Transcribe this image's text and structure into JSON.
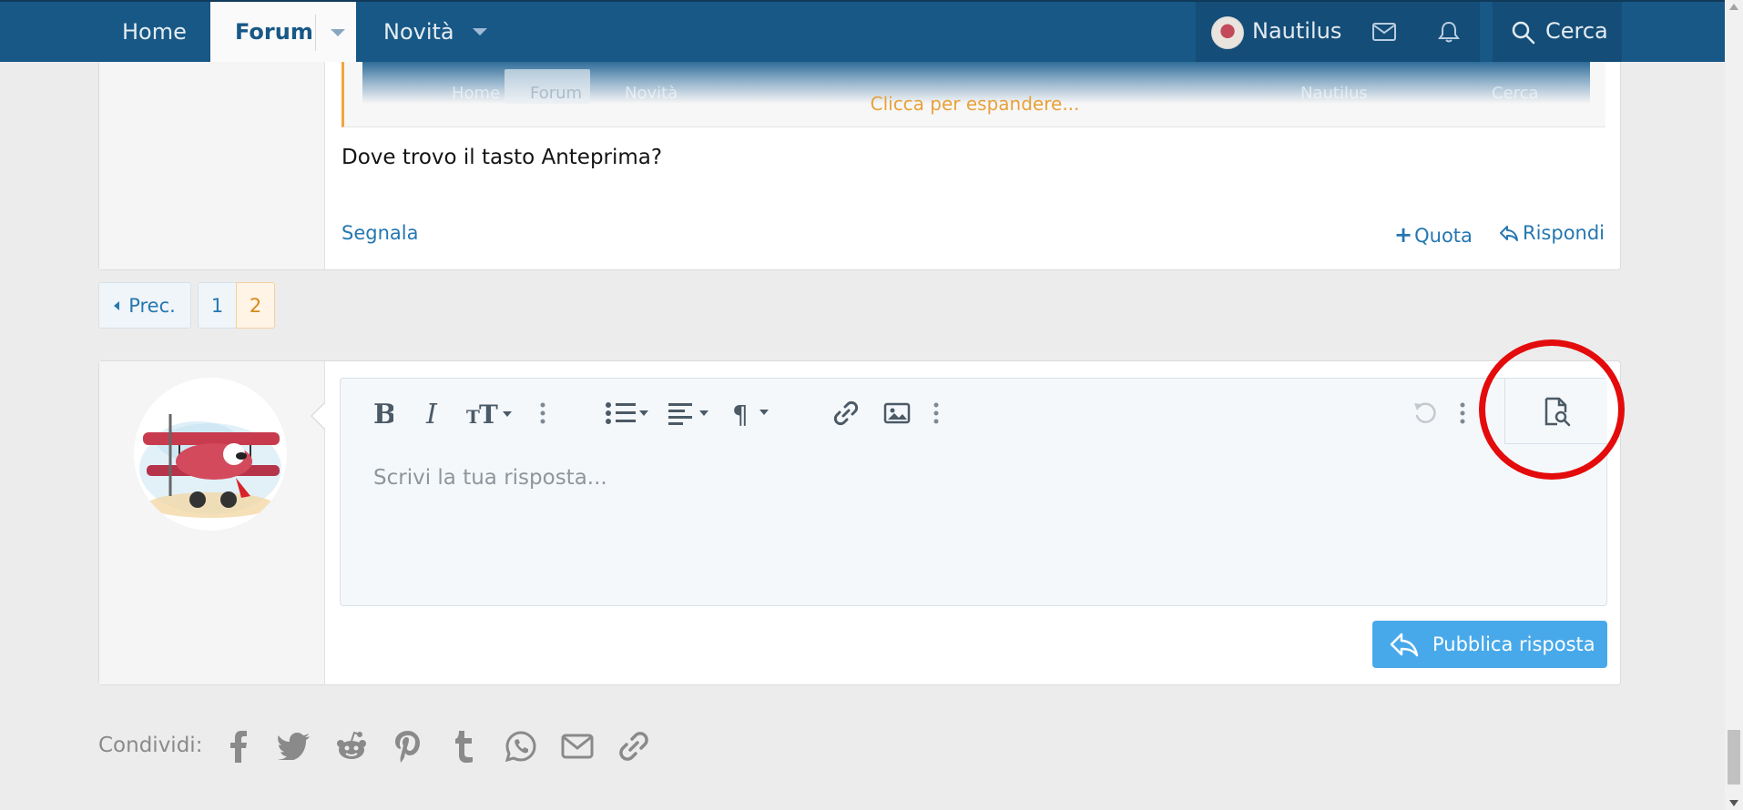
{
  "nav": {
    "home": "Home",
    "forum": "Forum",
    "novita": "Novità",
    "user": "Nautilus",
    "search": "Cerca"
  },
  "quote": {
    "ghost_home": "Home",
    "ghost_forum": "Forum",
    "ghost_novita": "Novità",
    "ghost_user": "Nautilus",
    "ghost_search": "Cerca",
    "expand": "Clicca per espandere..."
  },
  "post": {
    "text": "Dove trovo il tasto Anteprima?",
    "report": "Segnala",
    "quote": "Quota",
    "reply": "Rispondi"
  },
  "pagination": {
    "prev": "Prec.",
    "pages": [
      "1",
      "2"
    ],
    "current": "2"
  },
  "editor": {
    "placeholder": "Scrivi la tua risposta...",
    "submit": "Pubblica risposta"
  },
  "share": {
    "label": "Condividi:",
    "icons": [
      "facebook-icon",
      "twitter-icon",
      "reddit-icon",
      "pinterest-icon",
      "tumblr-icon",
      "whatsapp-icon",
      "email-icon",
      "link-icon"
    ]
  },
  "colors": {
    "nav_bg": "#185886",
    "link": "#2577b1",
    "accent_orange": "#e8a13a",
    "submit": "#48a9ea",
    "annotation": "#e30b0b"
  }
}
